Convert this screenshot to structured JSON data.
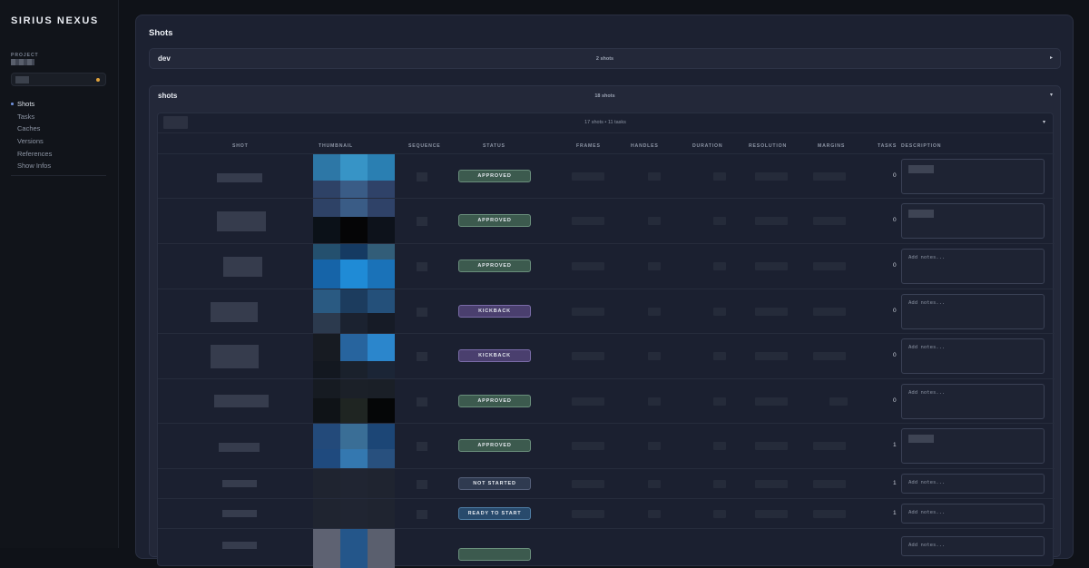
{
  "app": {
    "brand": "SIRIUS NEXUS"
  },
  "sidebar": {
    "project_label": "PROJECT",
    "nav": [
      {
        "label": "Shots",
        "active": true
      },
      {
        "label": "Tasks"
      },
      {
        "label": "Caches"
      },
      {
        "label": "Versions"
      },
      {
        "label": "References"
      },
      {
        "label": "Show Infos"
      }
    ]
  },
  "main": {
    "title": "Shots",
    "groups": [
      {
        "name": "dev",
        "count": "2 shots",
        "toggle": "▸"
      },
      {
        "name": "shots",
        "count": "18 shots",
        "toggle": "▾"
      }
    ],
    "subgroup": {
      "info": "17 shots • 11 tasks",
      "toggle": "▾"
    },
    "columns": [
      "SHOT",
      "THUMBNAIL",
      "SEQUENCE",
      "STATUS",
      "FRAMES",
      "HANDLES",
      "DURATION",
      "RESOLUTION",
      "MARGINS",
      "TASKS",
      "DESCRIPTION"
    ],
    "rows": [
      {
        "status": "APPROVED",
        "status_kind": "approved",
        "tasks": "0",
        "desc": ""
      },
      {
        "status": "APPROVED",
        "status_kind": "approved",
        "tasks": "0",
        "desc": ""
      },
      {
        "status": "APPROVED",
        "status_kind": "approved",
        "tasks": "0",
        "desc": "Add notes..."
      },
      {
        "status": "KICKBACK",
        "status_kind": "kickback",
        "tasks": "0",
        "desc": "Add notes..."
      },
      {
        "status": "KICKBACK",
        "status_kind": "kickback",
        "tasks": "0",
        "desc": "Add notes..."
      },
      {
        "status": "APPROVED",
        "status_kind": "approved",
        "tasks": "0",
        "desc": "Add notes..."
      },
      {
        "status": "APPROVED",
        "status_kind": "approved",
        "tasks": "1",
        "desc": ""
      },
      {
        "status": "NOT STARTED",
        "status_kind": "notstarted",
        "tasks": "1",
        "desc": "Add notes..."
      },
      {
        "status": "READY TO START",
        "status_kind": "ready",
        "tasks": "1",
        "desc": "Add notes..."
      },
      {
        "status": "",
        "status_kind": "approved",
        "tasks": "",
        "desc": "Add notes..."
      }
    ]
  },
  "colors": {
    "approved": "#3c5a4e",
    "kickback": "#4a3f6e",
    "not_started": "#2f3a50",
    "ready": "#284a6c",
    "accent": "#e0a23c"
  }
}
